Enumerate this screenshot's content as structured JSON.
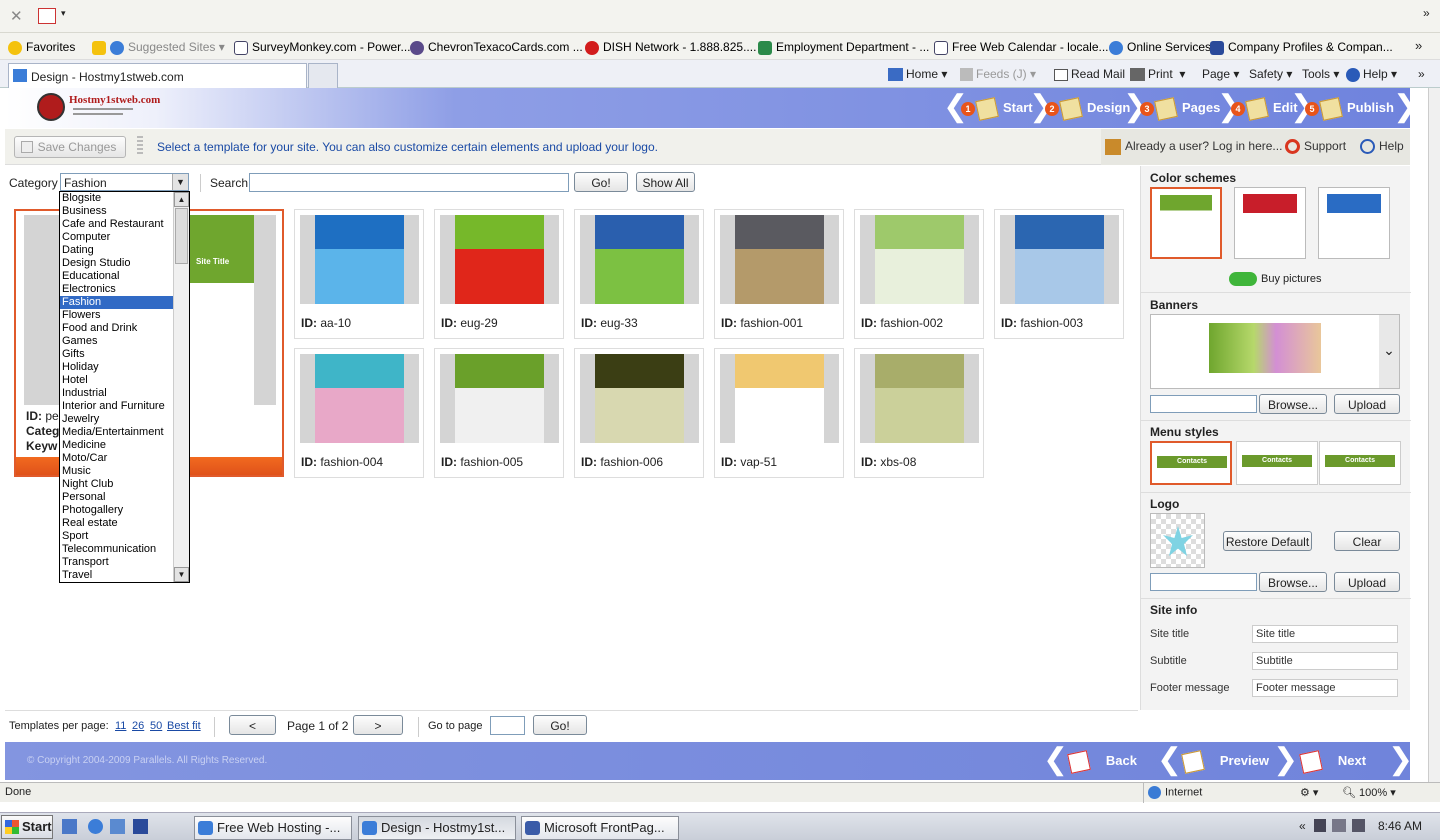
{
  "browser": {
    "favorites_label": "Favorites",
    "favorites": [
      "Suggested Sites ▾",
      "SurveyMonkey.com - Power...",
      "ChevronTexacoCards.com ...",
      "DISH Network - 1.888.825....",
      "Employment Department - ...",
      "Free Web Calendar - locale...",
      "Online Services",
      "Company Profiles & Compan..."
    ],
    "tab_title": "Design - Hostmy1stweb.com",
    "commands": {
      "home": "Home",
      "feeds": "Feeds (J)",
      "read_mail": "Read Mail",
      "print": "Print",
      "page": "Page",
      "safety": "Safety",
      "tools": "Tools",
      "help": "Help"
    }
  },
  "header": {
    "logo_text": "Hostmy1stweb.com",
    "steps": [
      {
        "num": "1",
        "label": "Start"
      },
      {
        "num": "2",
        "label": "Design"
      },
      {
        "num": "3",
        "label": "Pages"
      },
      {
        "num": "4",
        "label": "Edit"
      },
      {
        "num": "5",
        "label": "Publish"
      }
    ]
  },
  "infobar": {
    "save_label": "Save Changes",
    "hint": "Select a template for your site. You can also customize certain elements and upload your logo.",
    "login": "Already a user? Log in here...",
    "support": "Support",
    "help": "Help"
  },
  "filter": {
    "category_label": "Category",
    "category_value": "Fashion",
    "search_label": "Search",
    "search_value": "",
    "go_label": "Go!",
    "show_all_label": "Show All"
  },
  "categories": [
    "Blogsite",
    "Business",
    "Cafe and Restaurant",
    "Computer",
    "Dating",
    "Design Studio",
    "Educational",
    "Electronics",
    "Fashion",
    "Flowers",
    "Food and Drink",
    "Games",
    "Gifts",
    "Holiday",
    "Hotel",
    "Industrial",
    "Interior and Furniture",
    "Jewelry",
    "Media/Entertainment",
    "Medicine",
    "Moto/Car",
    "Music",
    "Night Club",
    "Personal",
    "Photogallery",
    "Real estate",
    "Sport",
    "Telecommunication",
    "Transport",
    "Travel"
  ],
  "selected_category": "Fashion",
  "preview": {
    "id_label": "ID:",
    "id_value": "pe",
    "category_label": "Categ",
    "keywords_label": "Keyw",
    "site_title": "Site Title"
  },
  "templates": [
    {
      "id": "aa-10",
      "colors": [
        "#1e6fc2",
        "#5bb4ea"
      ]
    },
    {
      "id": "eug-29",
      "colors": [
        "#76b82a",
        "#e0261a"
      ]
    },
    {
      "id": "eug-33",
      "colors": [
        "#2a5fae",
        "#7cc142"
      ]
    },
    {
      "id": "fashion-001",
      "colors": [
        "#5a5a60",
        "#b49a6a"
      ]
    },
    {
      "id": "fashion-002",
      "colors": [
        "#9ec96b",
        "#e8f0dc"
      ]
    },
    {
      "id": "fashion-003",
      "colors": [
        "#2b66b1",
        "#a8c8e8"
      ]
    },
    {
      "id": "fashion-004",
      "colors": [
        "#3fb5c8",
        "#e8a8c8"
      ]
    },
    {
      "id": "fashion-005",
      "colors": [
        "#6aa02a",
        "#f0f0f0"
      ]
    },
    {
      "id": "fashion-006",
      "colors": [
        "#3b3e14",
        "#d8d8b0"
      ]
    },
    {
      "id": "vap-51",
      "colors": [
        "#f0c870",
        "#ffffff"
      ]
    },
    {
      "id": "xbs-08",
      "colors": [
        "#a8ad6a",
        "#cbd09a"
      ]
    }
  ],
  "pager": {
    "per_page_label": "Templates per page:",
    "options": [
      "11",
      "26",
      "50",
      "Best fit"
    ],
    "prev": "<",
    "page_text": "Page 1 of 2",
    "next": ">",
    "goto_label": "Go to page",
    "go_label": "Go!"
  },
  "right": {
    "color_schemes_label": "Color schemes",
    "buy_pictures": "Buy pictures",
    "banners_label": "Banners",
    "browse": "Browse...",
    "upload": "Upload",
    "menu_styles_label": "Menu styles",
    "menu_item": "Contacts",
    "logo_label": "Logo",
    "restore_default": "Restore Default",
    "clear": "Clear",
    "site_info_label": "Site info",
    "fields": [
      {
        "label": "Site title",
        "value": "Site title"
      },
      {
        "label": "Subtitle",
        "value": "Subtitle"
      },
      {
        "label": "Footer message",
        "value": "Footer message"
      }
    ]
  },
  "footer": {
    "copyright": "© Copyright 2004-2009 Parallels. All Rights Reserved.",
    "back": "Back",
    "preview": "Preview",
    "next": "Next"
  },
  "status": {
    "text": "Done",
    "zone": "Internet",
    "zoom": "100%"
  },
  "taskbar": {
    "start": "Start",
    "tasks": [
      "Free Web Hosting -...",
      "Design - Hostmy1st...",
      "Microsoft FrontPag..."
    ],
    "clock": "8:46 AM"
  }
}
